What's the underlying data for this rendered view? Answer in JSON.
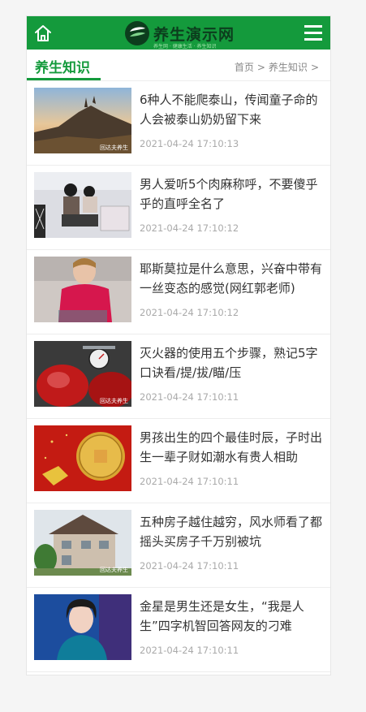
{
  "header": {
    "logo_text": "养生演示网",
    "logo_sub": "养生网 · 健康生活 · 养生知识",
    "colors": {
      "bar": "#149a3c",
      "accent": "#149a3c"
    },
    "home_icon": "home-icon",
    "menu_icon": "hamburger-menu-icon"
  },
  "section": {
    "title": "养生知识",
    "breadcrumb": [
      "首页",
      "养生知识"
    ],
    "sep": ">"
  },
  "articles": [
    {
      "title": "6种人不能爬泰山，传闻童子命的人会被泰山奶奶留下来",
      "date": "2021-04-24 17:10:13",
      "thumb": "mountain-sunset",
      "watermark": "回达夫养生"
    },
    {
      "title": "男人爱听5个肉麻称呼，不要傻乎乎的直呼全名了",
      "date": "2021-04-24 17:10:12",
      "thumb": "couple-illustration",
      "watermark": ""
    },
    {
      "title": "耶斯莫拉是什么意思，兴奋中带有一丝变态的感觉(网红郭老师)",
      "date": "2021-04-24 17:10:12",
      "thumb": "woman-red-sweater",
      "watermark": ""
    },
    {
      "title": "灭火器的使用五个步骤，熟记5字口诀看/提/拔/瞄/压",
      "date": "2021-04-24 17:10:11",
      "thumb": "fire-extinguisher",
      "watermark": "回达夫养生"
    },
    {
      "title": "男孩出生的四个最佳时辰，子时出生一辈子财如潮水有贵人相助",
      "date": "2021-04-24 17:10:11",
      "thumb": "gold-coin",
      "watermark": ""
    },
    {
      "title": "五种房子越住越穷，风水师看了都摇头买房子千万别被坑",
      "date": "2021-04-24 17:10:11",
      "thumb": "house",
      "watermark": "回达夫养生"
    },
    {
      "title": "金星是男生还是女生，“我是人生”四字机智回答网友的刁难",
      "date": "2021-04-24 17:10:11",
      "thumb": "portrait",
      "watermark": ""
    }
  ]
}
